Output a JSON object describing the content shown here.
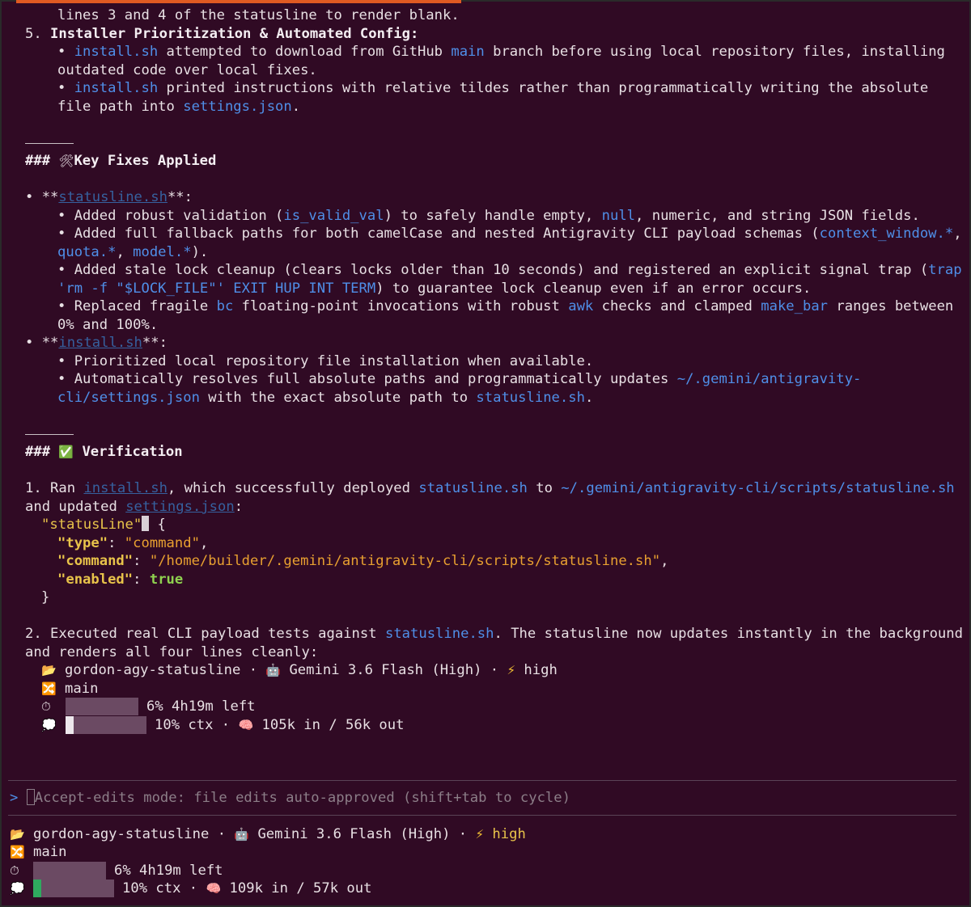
{
  "lines": {
    "l0": "lines 3 and 4 of the statusline to render blank.",
    "l1_num": "5. ",
    "l1_text": "Installer Prioritization & Automated Config:",
    "l2_pre": "• ",
    "l2_code": "install.sh",
    "l2_mid": " attempted to download from GitHub ",
    "l2_code2": "main",
    "l2_post": " branch before using local repository files, installing",
    "l3": "outdated code over local fixes.",
    "l4_pre": "• ",
    "l4_code": "install.sh",
    "l4_post": " printed instructions with relative tildes rather than programmatically writing the absolute",
    "l5_pre": "file path into ",
    "l5_code": "settings.json",
    "l5_post": ".",
    "h1_hash": "### ",
    "h1_icon": "🛠",
    "h1_text": "Key Fixes Applied",
    "s1_pre": "• **",
    "s1_link": "statusline.sh",
    "s1_post": "**:",
    "s1a_pre": "• Added robust validation (",
    "s1a_code": "is_valid_val",
    "s1a_post": ") to safely handle empty, ",
    "s1a_code2": "null",
    "s1a_post2": ", numeric, and string JSON fields.",
    "s1b_pre": "• Added full fallback paths for both camelCase and nested Antigravity CLI payload schemas (",
    "s1b_code": "context_window.*",
    "s1b_post": ",",
    "s1c_code": "quota.*",
    "s1c_mid": ", ",
    "s1c_code2": "model.*",
    "s1c_post": ").",
    "s1d_pre": "• Added stale lock cleanup (clears locks older than 10 seconds) and registered an explicit signal trap (",
    "s1d_code": "trap",
    "s1e_code": "'rm -f \"$LOCK_FILE\"' EXIT HUP INT TERM",
    "s1e_post": ") to guarantee lock cleanup even if an error occurs.",
    "s1f_pre": "• Replaced fragile ",
    "s1f_code": "bc",
    "s1f_mid": " floating-point invocations with robust ",
    "s1f_code2": "awk",
    "s1f_mid2": " checks and clamped ",
    "s1f_code3": "make_bar",
    "s1f_post": " ranges between",
    "s1g": "0% and 100%.",
    "s2_pre": "• **",
    "s2_link": "install.sh",
    "s2_post": "**:",
    "s2a": "• Prioritized local repository file installation when available.",
    "s2b_pre": "• Automatically resolves full absolute paths and programmatically updates ",
    "s2b_code": "~/.gemini/antigravity-",
    "s2c_code": "cli/settings.json",
    "s2c_mid": " with the exact absolute path to ",
    "s2c_code2": "statusline.sh",
    "s2c_post": ".",
    "h2_hash": "### ",
    "h2_icon": "✅",
    "h2_text": " Verification",
    "v1_pre": "1. Ran ",
    "v1_link": "install.sh",
    "v1_mid": ", which successfully deployed ",
    "v1_code": "statusline.sh",
    "v1_mid2": " to ",
    "v1_code2": "~/.gemini/antigravity-cli/scripts/statusline.sh",
    "v2_pre": "and updated ",
    "v2_link": "settings.json",
    "v2_post": ":",
    "j1_key": "\"statusLine\"",
    "j1_post": " {",
    "j2_key": "\"type\"",
    "j2_colon": ": ",
    "j2_val": "\"command\"",
    "j2_post": ",",
    "j3_key": "\"command\"",
    "j3_colon": ": ",
    "j3_val": "\"/home/builder/.gemini/antigravity-cli/scripts/statusline.sh\"",
    "j3_post": ",",
    "j4_key": "\"enabled\"",
    "j4_colon": ": ",
    "j4_val": "true",
    "j5": "}",
    "v3_pre": "2. Executed real CLI payload tests against ",
    "v3_code": "statusline.sh",
    "v3_post": ". The statusline now updates instantly in the background",
    "v4": "and renders all four lines cleanly:"
  },
  "inner_status": {
    "folder_icon": "📂",
    "project": "gordon-agy-statusline",
    "dot1": " · ",
    "robot_icon": "🤖",
    "model": "Gemini 3.6 Flash (High)",
    "dot2": " · ",
    "bolt_icon": "⚡",
    "effort": "high",
    "branch_icon": "🔀",
    "branch": "main",
    "timer_icon": "⏱",
    "quota_text": "6% 4h19m left",
    "ctx_icon": "💭",
    "ctx_text": "10% ctx",
    "dot3": " · ",
    "brain_icon": "🧠",
    "tokens": "105k in / 56k out",
    "quota_fraction": 0.06,
    "ctx_fraction": 0.1
  },
  "prompt": {
    "caret": ">",
    "placeholder": "Accept-edits mode: file edits auto-approved (shift+tab to cycle)"
  },
  "bottom_status": {
    "folder_icon": "📂",
    "project": "gordon-agy-statusline",
    "dot1": " · ",
    "robot_icon": "🤖",
    "model": "Gemini 3.6 Flash (High)",
    "dot2": " · ",
    "bolt_icon": "⚡",
    "effort": "high",
    "branch_icon": "🔀",
    "branch": "main",
    "timer_icon": "⏱",
    "quota_text": "6% 4h19m left",
    "ctx_icon": "💭",
    "ctx_text": "10% ctx",
    "dot3": " · ",
    "brain_icon": "🧠",
    "tokens": "109k in / 57k out",
    "quota_fraction": 0.06,
    "ctx_fraction": 0.1,
    "ctx_fill_color": "#2faa5f"
  },
  "colors": {
    "background": "#300a24",
    "code_blue": "#4f8fe8",
    "json_key": "#e8c34a",
    "json_value": "#e8a030",
    "json_true": "#8fd14f",
    "accent_bar": "#e05a22"
  }
}
